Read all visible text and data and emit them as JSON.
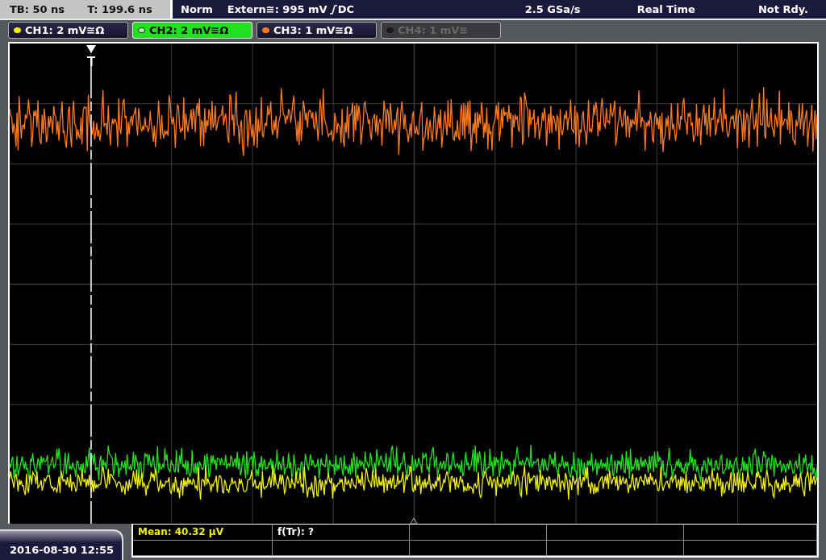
{
  "status_bar": {
    "timebase": "TB: 50 ns",
    "trigger_time": "T: 199.6 ns",
    "mode": "Norm",
    "trigger_source": "Extern≅: 995 mV",
    "trigger_coupling": "DC",
    "sample_rate": "2.5 GSa/s",
    "acquisition": "Real Time",
    "state": "Not Rdy."
  },
  "channels": [
    {
      "label": "CH1: 2 mV≅Ω",
      "color": "#f0f000",
      "selected": false,
      "disabled": false
    },
    {
      "label": "CH2: 2 mV≅Ω",
      "color": "#20e020",
      "selected": true,
      "disabled": false
    },
    {
      "label": "CH3: 1 mV≅Ω",
      "color": "#ff7a1a",
      "selected": false,
      "disabled": false
    },
    {
      "label": "CH4: 1 mV≅",
      "color": "#1a1a1a",
      "selected": false,
      "disabled": true
    }
  ],
  "date": "2016-08-30 12:55",
  "measurements": [
    {
      "text": "Mean: 40.32 µV",
      "color": "#f0f000"
    },
    {
      "text": "f(Tr): ?",
      "color": "#ffffff"
    }
  ]
}
